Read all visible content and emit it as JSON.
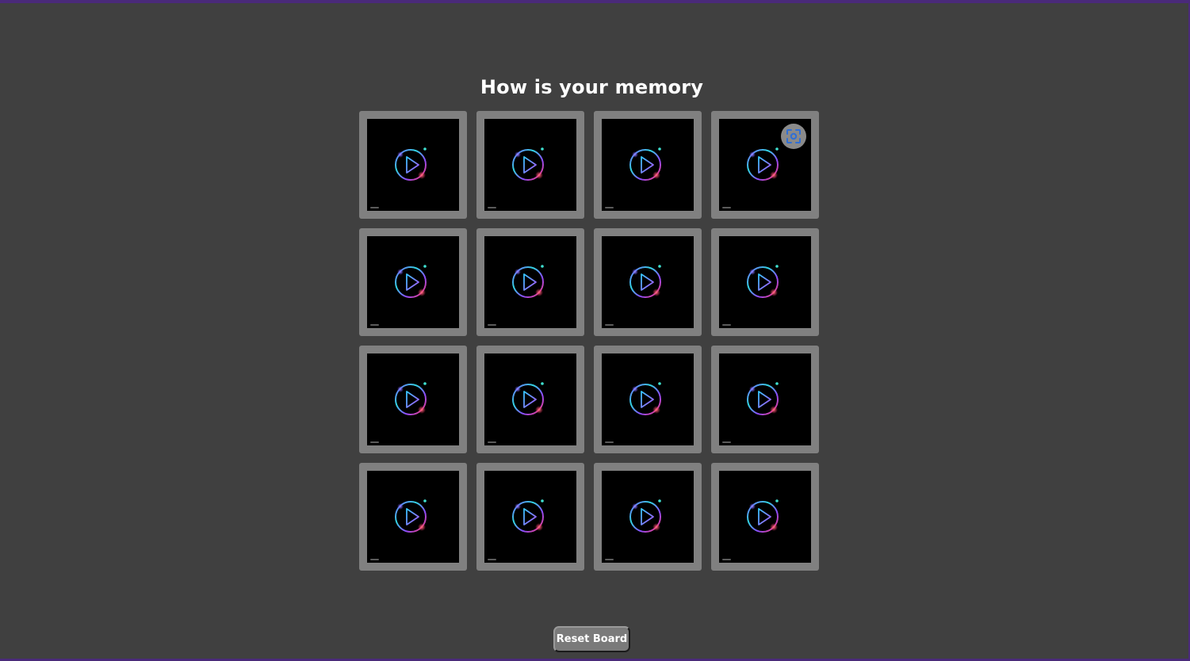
{
  "title": "How is your memory",
  "reset_button_label": "Reset Board",
  "card_count": 16,
  "card_face_icon": "neon-play-icon",
  "overlay_icon": "lens-scan-icon",
  "colors": {
    "page_background": "#404040",
    "window_border": "#4a2a7a",
    "card_frame": "#808080",
    "card_face": "#000000",
    "title_text": "#ffffff",
    "button_background": "#7a7a7a"
  }
}
